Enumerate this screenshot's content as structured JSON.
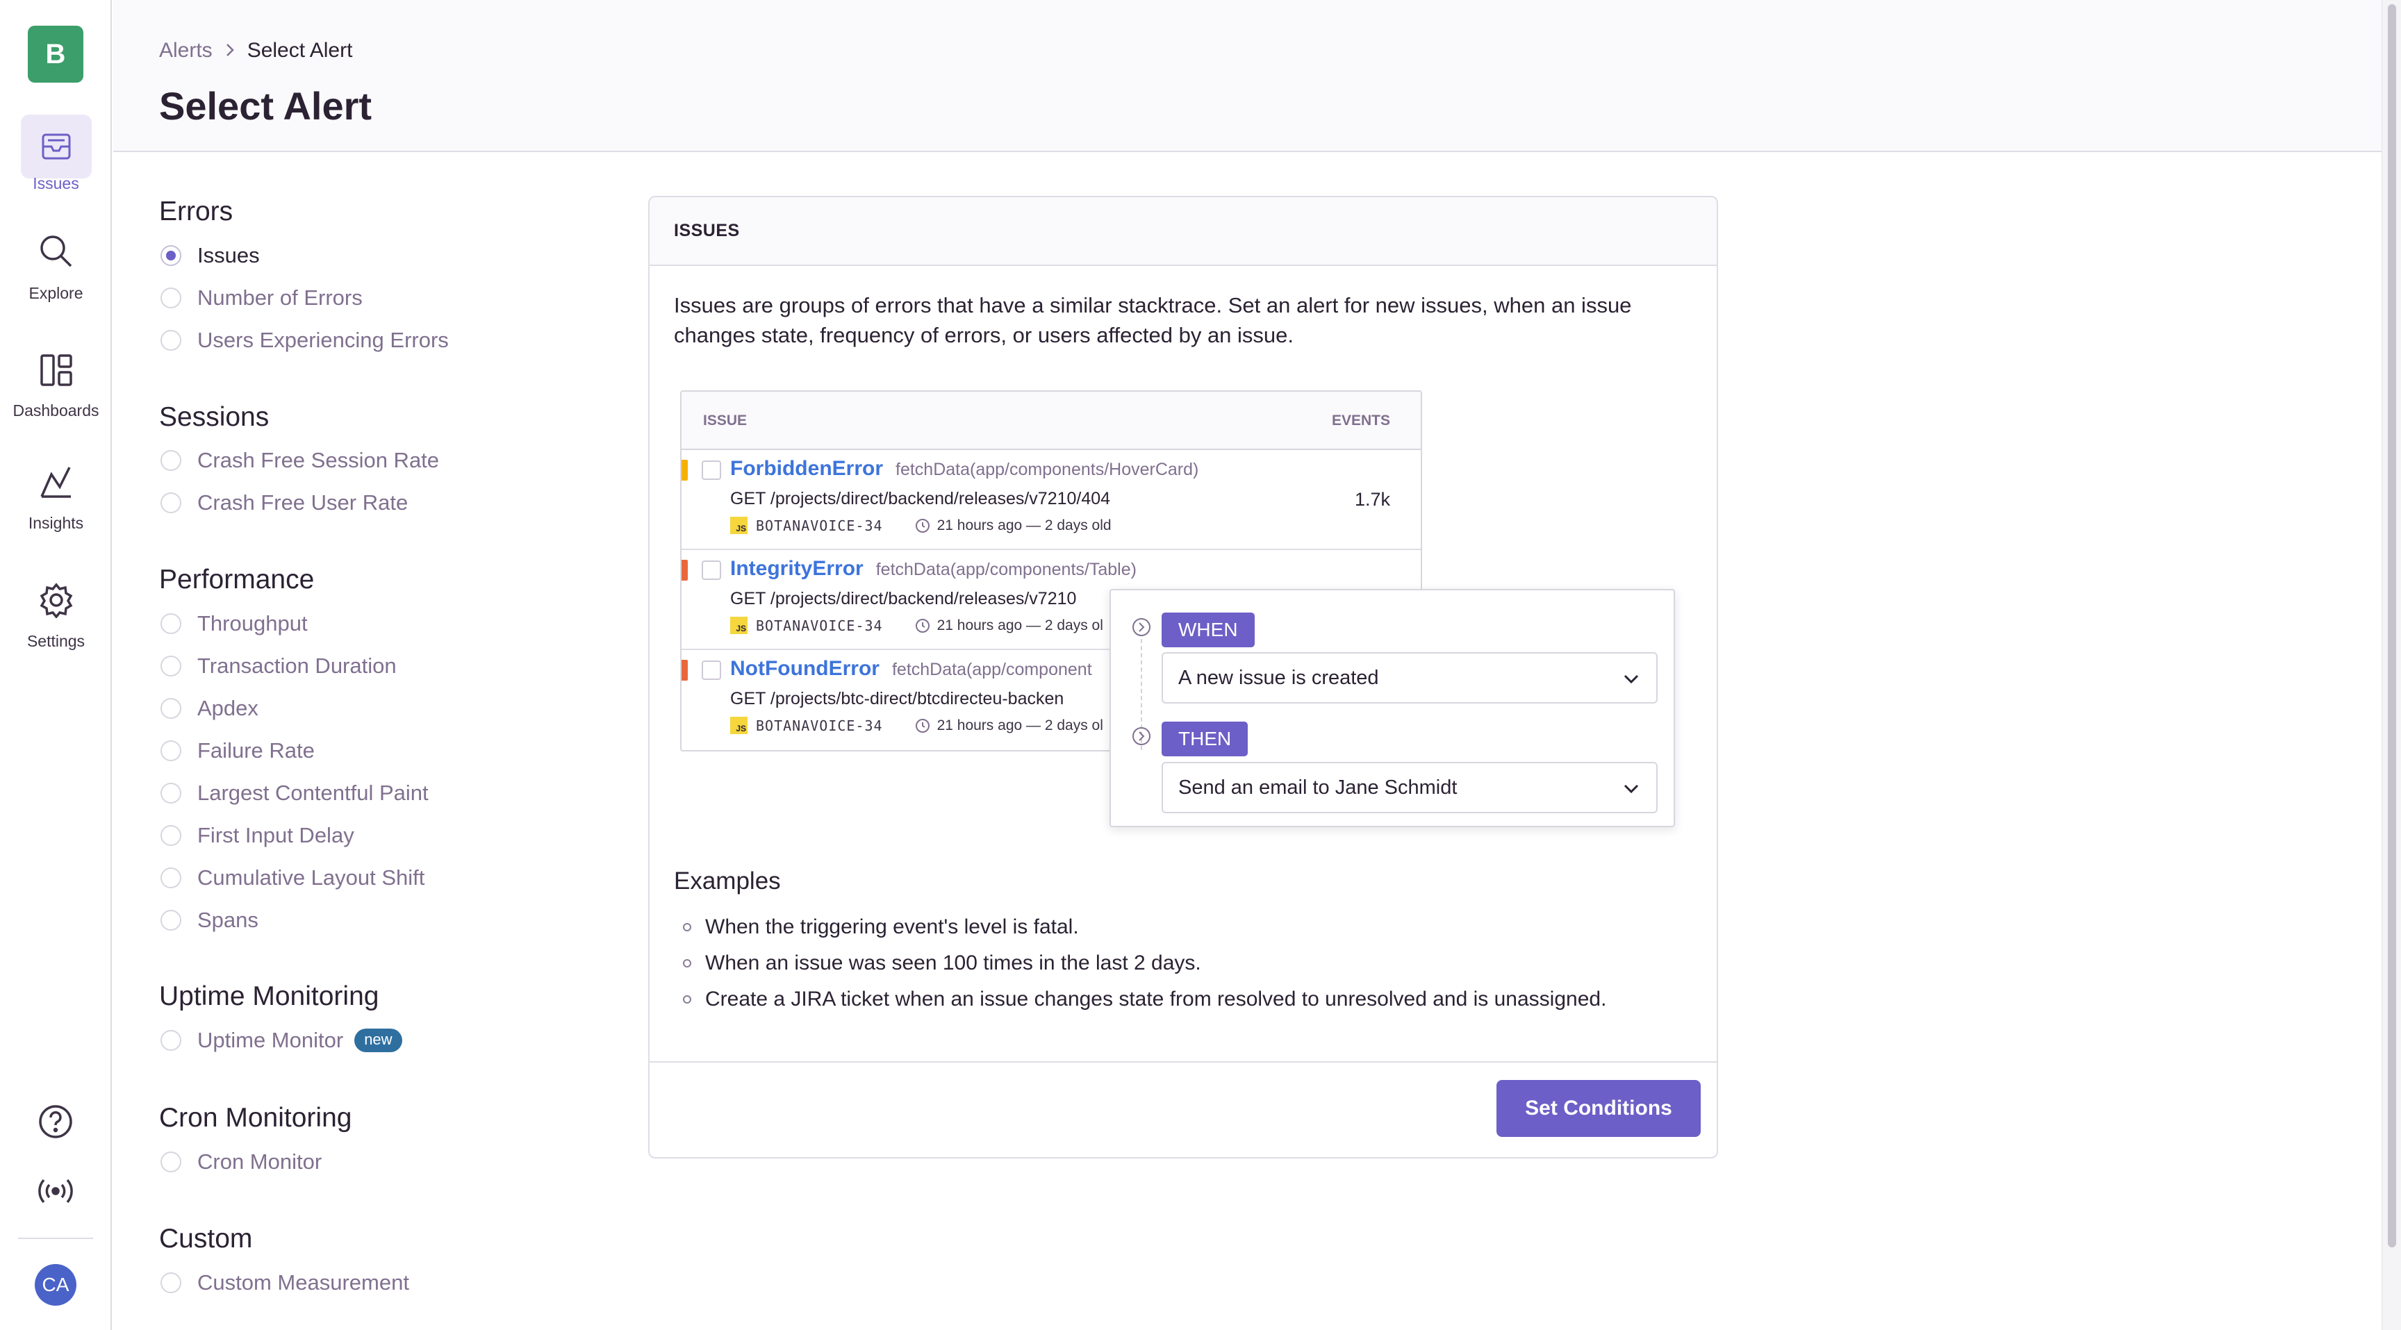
{
  "sidebar": {
    "org_initial": "B",
    "nav": [
      {
        "label": "Issues",
        "icon": "issues-icon",
        "active": true
      },
      {
        "label": "Explore",
        "icon": "search-icon"
      },
      {
        "label": "Dashboards",
        "icon": "dashboards-icon"
      },
      {
        "label": "Insights",
        "icon": "insights-icon"
      },
      {
        "label": "Settings",
        "icon": "gear-icon"
      }
    ],
    "bottom_icons": [
      "help-icon",
      "broadcast-icon"
    ],
    "user_initials": "CA"
  },
  "breadcrumb": {
    "parent": "Alerts",
    "current": "Select Alert"
  },
  "page_title": "Select Alert",
  "alert_groups": [
    {
      "title": "Errors",
      "options": [
        "Issues",
        "Number of Errors",
        "Users Experiencing Errors"
      ]
    },
    {
      "title": "Sessions",
      "options": [
        "Crash Free Session Rate",
        "Crash Free User Rate"
      ]
    },
    {
      "title": "Performance",
      "options": [
        "Throughput",
        "Transaction Duration",
        "Apdex",
        "Failure Rate",
        "Largest Contentful Paint",
        "First Input Delay",
        "Cumulative Layout Shift",
        "Spans"
      ]
    },
    {
      "title": "Uptime Monitoring",
      "options": [
        "Uptime Monitor"
      ],
      "badge": "new"
    },
    {
      "title": "Cron Monitoring",
      "options": [
        "Cron Monitor"
      ]
    },
    {
      "title": "Custom",
      "options": [
        "Custom Measurement"
      ]
    }
  ],
  "selected_option": "Issues",
  "panel": {
    "header": "ISSUES",
    "description": "Issues are groups of errors that have a similar stacktrace. Set an alert for new issues, when an issue changes state, frequency of errors, or users affected by an issue.",
    "preview": {
      "col_issue": "ISSUE",
      "col_events": "EVENTS",
      "rows": [
        {
          "title": "ForbiddenError",
          "culprit": "fetchData(app/components/HoverCard)",
          "message": "GET /projects/direct/backend/releases/v7210/404",
          "platform": "JS",
          "short_id": "BOTANAVOICE-34",
          "age": "21 hours ago — 2 days old",
          "events": "1.7k",
          "level_color": "#f5b000"
        },
        {
          "title": "IntegrityError",
          "culprit": "fetchData(app/components/Table)",
          "message": "GET /projects/direct/backend/releases/v7210",
          "platform": "JS",
          "short_id": "BOTANAVOICE-34",
          "age": "21 hours ago — 2 days ol",
          "events": "",
          "level_color": "#e9683b"
        },
        {
          "title": "NotFoundError",
          "culprit": "fetchData(app/component",
          "message": "GET /projects/btc-direct/btcdirecteu-backen",
          "platform": "JS",
          "short_id": "BOTANAVOICE-34",
          "age": "21 hours ago — 2 days ol",
          "events": "",
          "level_color": "#e9683b"
        }
      ]
    },
    "when_label": "WHEN",
    "when_value": "A new issue is created",
    "then_label": "THEN",
    "then_value": "Send an email to Jane Schmidt",
    "examples_title": "Examples",
    "examples": [
      "When the triggering event's level is fatal.",
      "When an issue was seen 100 times in the last 2 days.",
      "Create a JIRA ticket when an issue changes state from resolved to unresolved and is unassigned."
    ],
    "cta_label": "Set Conditions"
  },
  "colors": {
    "accent": "#6c5fc7",
    "link": "#3d74db",
    "org_avatar": "#3c9e6a",
    "user_avatar": "#4a63c9"
  }
}
